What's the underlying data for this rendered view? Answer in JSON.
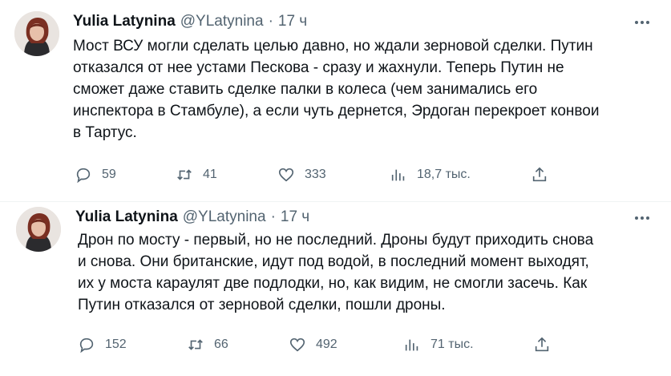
{
  "tweets": [
    {
      "name": "Yulia Latynina",
      "handle": "@YLatynina",
      "separator": "·",
      "time": "17 ч",
      "text": "Мост ВСУ могли сделать целью давно, но ждали зерновой сделки. Путин\nотказался от нее устами Пескова - сразу и жахнули. Теперь Путин не\nсможет даже ставить сделке палки в колеса (чем занимались его\nинспектора в Стамбуле), а если чуть дернется, Эрдоган перекроет конвои\nв Тартус.",
      "replies": "59",
      "retweets": "41",
      "likes": "333",
      "views": "18,7 тыс."
    },
    {
      "name": "Yulia Latynina",
      "handle": "@YLatynina",
      "separator": "·",
      "time": "17 ч",
      "text": "Дрон по мосту - первый, но не последний. Дроны будут приходить снова\nи снова. Они британские, идут под водой,  в последний момент выходят,\nих у моста караулят две подлодки, но, как видим, не смогли засечь. Как\nПутин отказался от зерновой сделки, пошли дроны.",
      "replies": "152",
      "retweets": "66",
      "likes": "492",
      "views": "71 тыс."
    }
  ],
  "icons": {
    "more": "more-horizontal-icon",
    "reply": "reply-icon",
    "retweet": "retweet-icon",
    "like": "heart-icon",
    "views": "views-chart-icon",
    "share": "share-icon"
  },
  "colors": {
    "text": "#0f1419",
    "secondary": "#536471",
    "divider": "#eff3f4"
  }
}
